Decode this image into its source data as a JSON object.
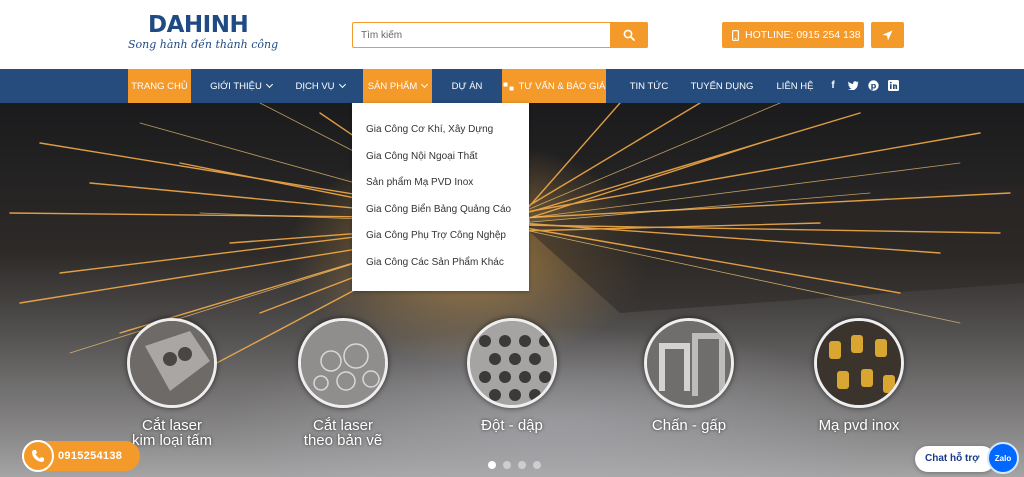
{
  "brand": {
    "name": "DAHINH",
    "tagline": "Song hành đến thành công"
  },
  "search": {
    "placeholder": "Tìm kiếm",
    "icon": "search-icon"
  },
  "hotline": {
    "label": "HOTLINE: 0915 254 138",
    "icon": "mobile-icon"
  },
  "locate": {
    "icon": "location-arrow-icon"
  },
  "nav": {
    "items": [
      {
        "label": "TRANG CHỦ"
      },
      {
        "label": "GIỚI THIỆU"
      },
      {
        "label": "DỊCH VỤ"
      },
      {
        "label": "SẢN PHẨM"
      },
      {
        "label": "DỰ ÁN"
      },
      {
        "label": "TƯ VẤN & BÁO GIÁ"
      },
      {
        "label": "TIN TỨC"
      },
      {
        "label": "TUYỂN DỤNG"
      },
      {
        "label": "LIÊN HỆ"
      }
    ],
    "social": [
      "facebook-icon",
      "twitter-icon",
      "pinterest-icon",
      "linkedin-icon"
    ]
  },
  "dropdown": {
    "items": [
      "Gia Công Cơ Khí, Xây Dựng",
      "Gia Công Nội Ngoại Thất",
      "Sản phẩm Mạ PVD Inox",
      "Gia Công Biển Bảng Quảng Cáo",
      "Gia Công Phụ Trợ Công Nghệp",
      "Gia Công Các Sản Phẩm Khác"
    ]
  },
  "services": [
    {
      "line1": "Cắt laser",
      "line2": "kim loại tấm"
    },
    {
      "line1": "Cắt laser",
      "line2": "theo bản vẽ"
    },
    {
      "line1": "Đột - dập",
      "line2": ""
    },
    {
      "line1": "Chấn - gấp",
      "line2": ""
    },
    {
      "line1": "Mạ pvd inox",
      "line2": ""
    }
  ],
  "slider": {
    "slides": 4,
    "active": 1
  },
  "float_phone": {
    "number": "0915254138"
  },
  "chat": {
    "label": "Chat hỗ trợ",
    "badge": "Zalo"
  },
  "colors": {
    "accent": "#f39a2b",
    "nav": "#254c7d",
    "brand": "#1f4a84"
  }
}
